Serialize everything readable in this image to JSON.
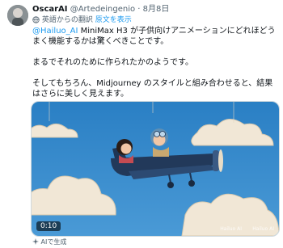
{
  "post": {
    "author_name": "OscarAI",
    "handle": "@Artedeingenio",
    "separator": "·",
    "date": "8月8日",
    "translation_note": "英語からの翻訳",
    "translation_link": "原文を表示",
    "mention": "@Hailuo_AI",
    "paragraph1_rest": " MiniMax H3 が子供向けアニメーションにどれほどうまく機能するかは驚くべきことです。",
    "paragraph2": "まるでそれのために作られたかのようです。",
    "paragraph3": "そしてもちろん、Midjourney のスタイルと組み合わせると、結果はさらに美しく見えます。"
  },
  "media": {
    "duration": "0:10",
    "watermark_left": "Hailuo AI",
    "watermark_right": "Hailuo AI"
  },
  "footer": {
    "ai_label": "AIで生成"
  },
  "icons": {
    "globe": "globe-icon",
    "sparkle": "ai-sparkle-icon"
  },
  "colors": {
    "link": "#1d9bf0",
    "secondary_text": "#536471",
    "sky": "#2f86c8"
  }
}
